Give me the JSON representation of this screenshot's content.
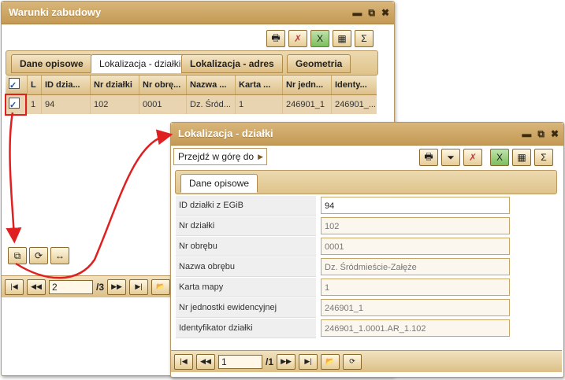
{
  "main_window": {
    "title": "Warunki zabudowy",
    "tabs": [
      "Dane opisowe",
      "Lokalizacja - działki",
      "Lokalizacja - adres",
      "Geometria"
    ],
    "grid": {
      "headers": [
        "L",
        "ID dzia...",
        "Nr działki",
        "Nr obrę...",
        "Nazwa ...",
        "Karta ...",
        "Nr jedn...",
        "Identy..."
      ],
      "row": [
        "1",
        "94",
        "102",
        "0001",
        "Dz. Śród...",
        "1",
        "246901_1",
        "246901_..."
      ]
    },
    "pager": {
      "page": "2",
      "total": "/3"
    }
  },
  "detail_window": {
    "title": "Lokalizacja - działki",
    "goto_label": "Przejdź w górę do",
    "tab": "Dane opisowe",
    "fields": [
      {
        "label": "ID działki z EGiB",
        "value": "94"
      },
      {
        "label": "Nr działki",
        "value": "102"
      },
      {
        "label": "Nr obrębu",
        "value": "0001"
      },
      {
        "label": "Nazwa obrębu",
        "value": "Dz. Śródmieście-Załęże"
      },
      {
        "label": "Karta mapy",
        "value": "1"
      },
      {
        "label": "Nr jednostki ewidencyjnej",
        "value": "246901_1"
      },
      {
        "label": "Identyfikator działki",
        "value": "246901_1.0001.AR_1.102"
      }
    ],
    "pager": {
      "page": "1",
      "total": "/1"
    }
  },
  "colors": {
    "accent": "#c49a55",
    "highlight": "#e02020"
  }
}
